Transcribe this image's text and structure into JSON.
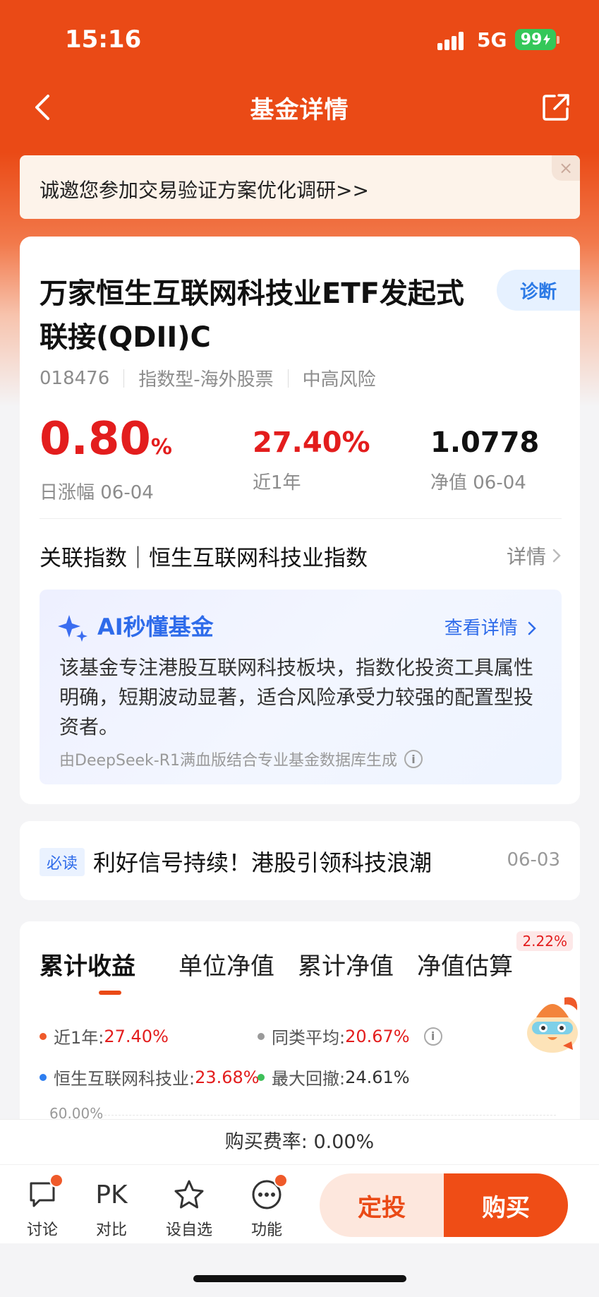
{
  "status_bar": {
    "time": "15:16",
    "network": "5G",
    "battery": "99"
  },
  "nav": {
    "title": "基金详情"
  },
  "survey": {
    "text": "诚邀您参加交易验证方案优化调研>>",
    "close": "×"
  },
  "fund": {
    "name": "万家恒生互联网科技业ETF发起式联接(QDII)C",
    "diagnose_label": "诊断",
    "code": "018476",
    "type": "指数型-海外股票",
    "risk": "中高风险",
    "daily_change_value": "0.80",
    "daily_change_unit": "%",
    "daily_change_label": "日涨幅 06-04",
    "one_year_return": "27.40%",
    "one_year_label": "近1年",
    "nav_value": "1.0778",
    "nav_label": "净值 06-04"
  },
  "related_index": {
    "label": "关联指数｜恒生互联网科技业指数",
    "detail": "详情"
  },
  "ai_summary": {
    "title": "AI秒懂基金",
    "more": "查看详情",
    "body": "该基金专注港股互联网科技板块，指数化投资工具属性明确，短期波动显著，适合风险承受力较强的配置型投资者。",
    "source": "由DeepSeek-R1满血版结合专业基金数据库生成"
  },
  "news": {
    "tag": "必读",
    "title": "利好信号持续！港股引领科技浪潮",
    "date": "06-03"
  },
  "chart_tabs": {
    "tabs": [
      "累计收益",
      "单位净值",
      "累计净值",
      "净值估算"
    ],
    "badge": "2.22%"
  },
  "legend": {
    "item1_label": "近1年:",
    "item1_value": "27.40%",
    "item1_color": "#ef5a2a",
    "item2_label": "同类平均:",
    "item2_value": "20.67%",
    "item2_color": "#9a9a9a",
    "item3_label": "恒生互联网科技业:",
    "item3_value": "23.68%",
    "item3_color": "#2e7ef0",
    "item4_label": "最大回撤:",
    "item4_value": "24.61%",
    "item4_color": "#3ec05a"
  },
  "chart_axis": {
    "top_label": "60.00%"
  },
  "fee": {
    "text": "购买费率: 0.00%"
  },
  "toolbar": {
    "discuss": "讨论",
    "compare_icon": "PK",
    "compare": "对比",
    "watchlist": "设自选",
    "functions": "功能",
    "sip": "定投",
    "buy": "购买"
  },
  "colors": {
    "brand": "#ea4a16",
    "rise": "#e31d1d",
    "link": "#2e6bea"
  }
}
